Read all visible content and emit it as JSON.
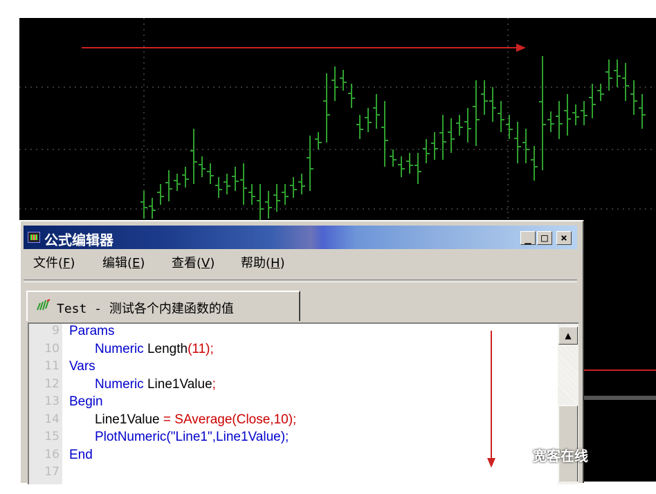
{
  "window": {
    "title": "公式编辑器",
    "controls": {
      "minimize": "_",
      "maximize": "□",
      "close": "×"
    }
  },
  "menu": {
    "items": [
      {
        "label": "文件(",
        "key": "F",
        "end": ")"
      },
      {
        "label": "编辑(",
        "key": "E",
        "end": ")"
      },
      {
        "label": "查看(",
        "key": "V",
        "end": ")"
      },
      {
        "label": "帮助(",
        "key": "H",
        "end": ")"
      }
    ]
  },
  "tab": {
    "label": "Test - 测试各个内建函数的值",
    "icon": "chart-bars-icon"
  },
  "code": {
    "line_numbers": [
      "9",
      "10",
      "11",
      "12",
      "13",
      "14",
      "15",
      "16",
      "17"
    ],
    "lines": [
      [
        {
          "t": "Params",
          "c": "kw"
        }
      ],
      [
        {
          "t": "       "
        },
        {
          "t": "Numeric",
          "c": "kw"
        },
        {
          "t": " Length"
        },
        {
          "t": "(11);",
          "c": "num"
        }
      ],
      [
        {
          "t": "Vars",
          "c": "kw"
        }
      ],
      [
        {
          "t": "       "
        },
        {
          "t": "Numeric",
          "c": "kw"
        },
        {
          "t": " Line1Value"
        },
        {
          "t": ";",
          "c": "op"
        }
      ],
      [
        {
          "t": "Begin",
          "c": "kw"
        }
      ],
      [
        {
          "t": "       Line1Value "
        },
        {
          "t": "=",
          "c": "op"
        },
        {
          "t": " SAverage(Close,10);",
          "c": "op"
        }
      ],
      [
        {
          "t": "       "
        },
        {
          "t": "PlotNumeric(",
          "c": "kw"
        },
        {
          "t": "\"Line1\"",
          "c": "str"
        },
        {
          "t": ",Line1Value);",
          "c": "kw"
        }
      ],
      [
        {
          "t": "End",
          "c": "kw"
        }
      ],
      []
    ]
  },
  "watermark": "宽客在线",
  "colors": {
    "chart_bg": "#000000",
    "bar_color": "#2fa12f",
    "grid_color": "#707070",
    "annotation_arrow": "#cc2222",
    "title_bar_start": "#0a246a"
  }
}
